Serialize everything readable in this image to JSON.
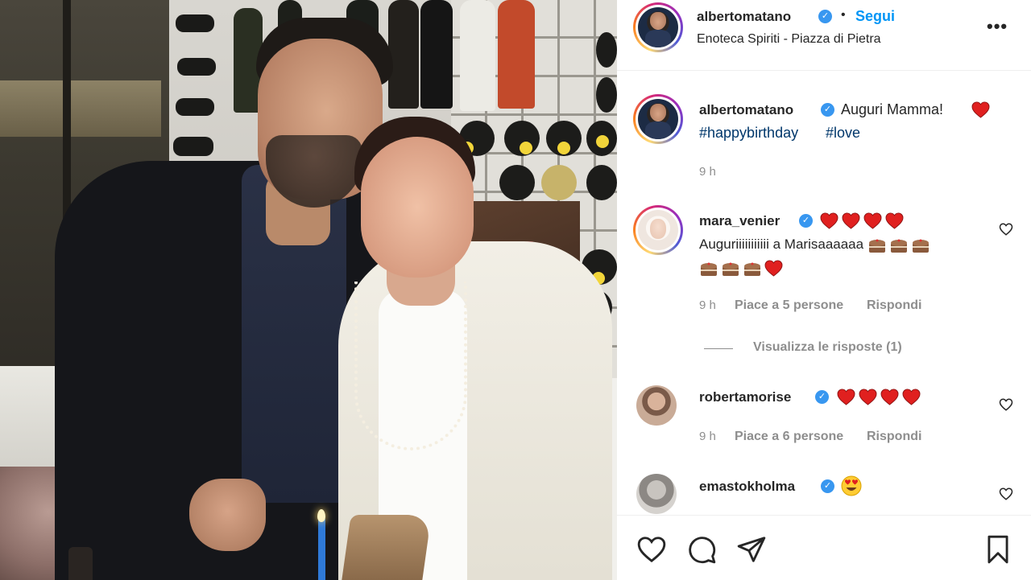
{
  "post": {
    "username": "albertomatano",
    "follow_label": "Segui",
    "separator": "•",
    "location": "Enoteca Spiriti - Piazza di Pietra",
    "more_icon": "more-options-icon",
    "more_label": "•••"
  },
  "caption": {
    "username": "albertomatano",
    "text": "Auguri Mamma!",
    "hashtag1": "#happybirthday",
    "hashtag2": "#love",
    "time": "9 h"
  },
  "comments": [
    {
      "username": "mara_venier",
      "text": "Auguriiiiiiiiiii a Marisaaaaaa",
      "time": "9 h",
      "likes": "Piace a 5 persone",
      "reply": "Rispondi",
      "view_replies": "Visualizza le risposte (1)"
    },
    {
      "username": "robertamorise",
      "time": "9 h",
      "likes": "Piace a 6 persone",
      "reply": "Rispondi"
    },
    {
      "username": "emastokholma"
    }
  ],
  "actions": [
    "like-icon",
    "comment-icon",
    "share-icon",
    "save-icon"
  ],
  "colors": {
    "link_blue": "#0095f6",
    "hashtag": "#00376b",
    "verified": "#3897f0",
    "heart_red": "#ed4956",
    "muted": "#8e8e8e"
  }
}
